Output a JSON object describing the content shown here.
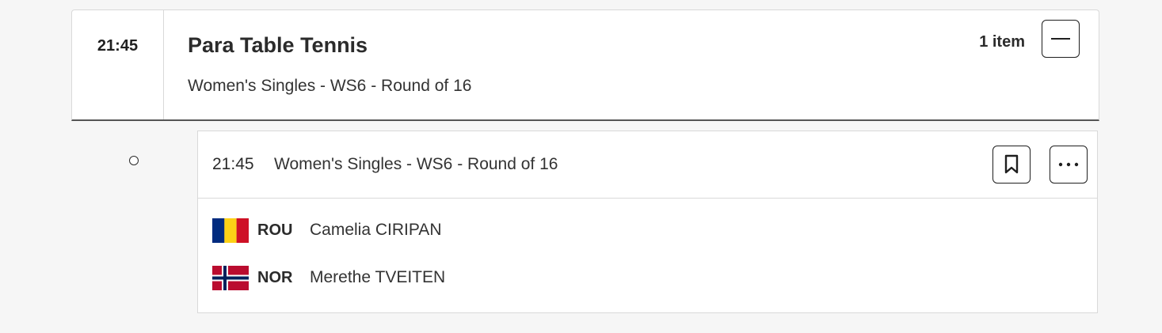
{
  "session": {
    "time": "21:45",
    "title": "Para Table Tennis",
    "subtitle": "Women's Singles - WS6 - Round of 16",
    "item_count": "1 item",
    "collapse_icon": "minus-icon"
  },
  "event": {
    "time": "21:45",
    "name": "Women's Singles - WS6 - Round of 16",
    "bookmark_icon": "bookmark-icon",
    "more_icon": "more-horizontal-icon",
    "competitors": [
      {
        "noc": "ROU",
        "name": "Camelia CIRIPAN",
        "flag_colors": [
          "#002B7F",
          "#FCD116",
          "#CE1126"
        ]
      },
      {
        "noc": "NOR",
        "name": "Merethe TVEITEN",
        "flag_colors": [
          "#BA0C2F",
          "#FFFFFF",
          "#00205B"
        ]
      }
    ]
  },
  "colors": {
    "page_background": "#f6f6f6",
    "card_background": "#ffffff",
    "border": "#d9d9d9",
    "text": "#2b2b2b"
  }
}
